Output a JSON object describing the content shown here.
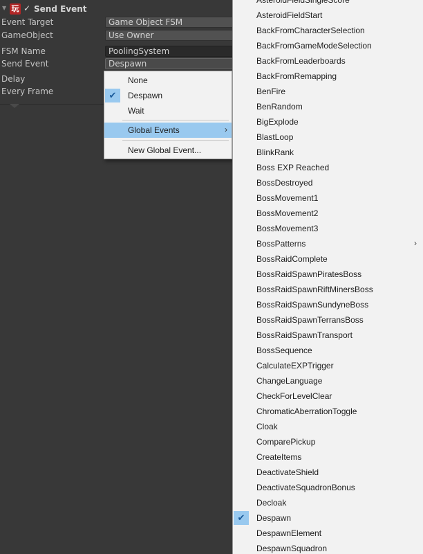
{
  "action": {
    "title": "Send Event",
    "logo_glyph": "玩",
    "enabled_check": "✓",
    "fold_glyph": "▼"
  },
  "fields": {
    "event_target": {
      "label": "Event Target",
      "value": "Game Object FSM"
    },
    "game_object": {
      "label": "GameObject",
      "value": "Use Owner"
    },
    "fsm_name": {
      "label": "FSM Name",
      "value": "PoolingSystem"
    },
    "send_event": {
      "label": "Send Event",
      "value": "Despawn"
    },
    "delay": {
      "label": "Delay"
    },
    "every_frame": {
      "label": "Every Frame"
    }
  },
  "event_menu": {
    "items": [
      {
        "label": "None",
        "checked": false
      },
      {
        "label": "Despawn",
        "checked": true
      },
      {
        "label": "Wait",
        "checked": false
      }
    ],
    "global_events": {
      "label": "Global Events",
      "arrow": "›"
    },
    "new_global_event": {
      "label": "New Global Event..."
    },
    "check_glyph": "✔"
  },
  "global_events_list": {
    "items": [
      {
        "label": "AsteroidFieldSingleScore"
      },
      {
        "label": "AsteroidFieldStart"
      },
      {
        "label": "BackFromCharacterSelection"
      },
      {
        "label": "BackFromGameModeSelection"
      },
      {
        "label": "BackFromLeaderboards"
      },
      {
        "label": "BackFromRemapping"
      },
      {
        "label": "BenFire"
      },
      {
        "label": "BenRandom"
      },
      {
        "label": "BigExplode"
      },
      {
        "label": "BlastLoop"
      },
      {
        "label": "BlinkRank"
      },
      {
        "label": "Boss EXP Reached"
      },
      {
        "label": "BossDestroyed"
      },
      {
        "label": "BossMovement1"
      },
      {
        "label": "BossMovement2"
      },
      {
        "label": "BossMovement3"
      },
      {
        "label": "BossPatterns",
        "submenu": true
      },
      {
        "label": "BossRaidComplete"
      },
      {
        "label": "BossRaidSpawnPiratesBoss"
      },
      {
        "label": "BossRaidSpawnRiftMinersBoss"
      },
      {
        "label": "BossRaidSpawnSundyneBoss"
      },
      {
        "label": "BossRaidSpawnTerransBoss"
      },
      {
        "label": "BossRaidSpawnTransport"
      },
      {
        "label": "BossSequence"
      },
      {
        "label": "CalculateEXPTrigger"
      },
      {
        "label": "ChangeLanguage"
      },
      {
        "label": "CheckForLevelClear"
      },
      {
        "label": "ChromaticAberrationToggle"
      },
      {
        "label": "Cloak"
      },
      {
        "label": "ComparePickup"
      },
      {
        "label": "CreateItems"
      },
      {
        "label": "DeactivateShield"
      },
      {
        "label": "DeactivateSquadronBonus"
      },
      {
        "label": "Decloak"
      },
      {
        "label": "Despawn",
        "checked": true
      },
      {
        "label": "DespawnElement"
      },
      {
        "label": "DespawnSquadron"
      }
    ],
    "submenu_arrow": "›",
    "check_glyph": "✔"
  },
  "colors": {
    "panel_bg": "#383838",
    "menu_bg": "#f2f2f2",
    "highlight": "#99c9ef",
    "logo_red": "#b22626"
  }
}
